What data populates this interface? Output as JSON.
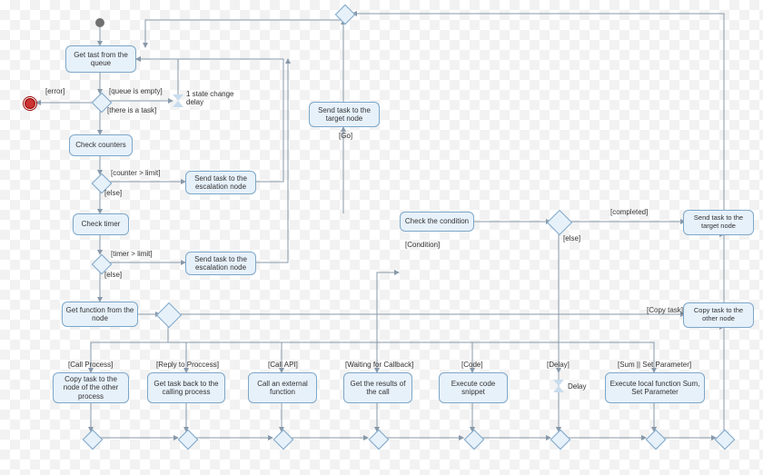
{
  "chart_data": {
    "type": "activity-diagram",
    "title": "",
    "nodes": [
      {
        "id": "start",
        "kind": "initial"
      },
      {
        "id": "errorEnd",
        "kind": "final"
      },
      {
        "id": "getTask",
        "kind": "action",
        "label": "Get tast from\nthe queue"
      },
      {
        "id": "d_queue",
        "kind": "decision"
      },
      {
        "id": "delayState",
        "kind": "timer",
        "label": "1 state change\ndelay"
      },
      {
        "id": "checkCounters",
        "kind": "action",
        "label": "Check counters"
      },
      {
        "id": "d_counter",
        "kind": "decision"
      },
      {
        "id": "escal1",
        "kind": "action",
        "label": "Send task to the\nescalation node"
      },
      {
        "id": "checkTimer",
        "kind": "action",
        "label": "Check timer"
      },
      {
        "id": "d_timer",
        "kind": "decision"
      },
      {
        "id": "escal2",
        "kind": "action",
        "label": "Send task to the\nescalation node"
      },
      {
        "id": "getFunc",
        "kind": "action",
        "label": "Get function from\nthe node"
      },
      {
        "id": "d_func",
        "kind": "decision"
      },
      {
        "id": "copyTaskProc",
        "kind": "action",
        "label": "Copy task to the\nnode of the other\nprocess"
      },
      {
        "id": "getBack",
        "kind": "action",
        "label": "Get task back to\nthe calling process"
      },
      {
        "id": "callApi",
        "kind": "action",
        "label": "Call an external\nfunction"
      },
      {
        "id": "getResults",
        "kind": "action",
        "label": "Get the results\nof the call"
      },
      {
        "id": "execCode",
        "kind": "action",
        "label": "Execute code\nsnippet"
      },
      {
        "id": "delay2",
        "kind": "timer",
        "label": "Delay"
      },
      {
        "id": "execLocal",
        "kind": "action",
        "label": "Execute local function\nSum, Set Parameter"
      },
      {
        "id": "sendTarget1",
        "kind": "action",
        "label": "Send task to the\ntarget node"
      },
      {
        "id": "checkCond",
        "kind": "action",
        "label": "Check the condition"
      },
      {
        "id": "d_cond",
        "kind": "decision"
      },
      {
        "id": "sendTarget2",
        "kind": "action",
        "label": "Send task to the\ntarget node"
      },
      {
        "id": "copyOther",
        "kind": "action",
        "label": "Copy task to the\nother node"
      },
      {
        "id": "merge_top",
        "kind": "merge"
      },
      {
        "id": "merge_bottom",
        "kind": "merge"
      }
    ],
    "guards": {
      "error": "[error]",
      "queueEmpty": "[queue is empty]",
      "thereTask": "[there is a task]",
      "counterLimit": "[counter > limit]",
      "else1": "[else]",
      "timerLimit": "[timer > limit]",
      "else2": "[else]",
      "go": "[Go]",
      "condition": "[Condition]",
      "else3": "[else]",
      "completed": "[completed]",
      "copyTask": "[Copy task]",
      "callProcess": "[Call Process]",
      "replyProcess": "[Reply to Proccess]",
      "callAPI": "[Call API]",
      "waitCb": "[Waiting for Callback]",
      "code": "[Code]",
      "delay": "[Delay]",
      "sumSet": "[Sum || Set Parameter]"
    }
  },
  "labels": {
    "getTask": "Get tast from the queue",
    "checkCounters": "Check counters",
    "escal1": "Send task to the escalation node",
    "checkTimer": "Check timer",
    "escal2": "Send task to the escalation node",
    "getFunc": "Get function from the node",
    "copyTaskProc": "Copy task to the node of the other process",
    "getBack": "Get task back to the calling process",
    "callApi": "Call an external function",
    "getResults": "Get the results of the call",
    "execCode": "Execute code snippet",
    "execLocal": "Execute local function Sum, Set Parameter",
    "sendTarget1": "Send task to the target node",
    "checkCond": "Check the condition",
    "sendTarget2": "Send task to the target node",
    "copyOther": "Copy task to the other node",
    "stateDelay": "1 state change delay",
    "delay": "Delay"
  },
  "guards": {
    "error": "[error]",
    "queueEmpty": "[queue is empty]",
    "thereTask": "[there is a task]",
    "counterLimit": "[counter > limit]",
    "else1": "[else]",
    "timerLimit": "[timer > limit]",
    "else2": "[else]",
    "go": "[Go]",
    "condition": "[Condition]",
    "else3": "[else]",
    "completed": "[completed]",
    "copyTask": "[Copy task]",
    "callProcess": "[Call Process]",
    "replyProcess": "[Reply to Proccess]",
    "callAPI": "[Call API]",
    "waitCb": "[Waiting for Callback]",
    "code": "[Code]",
    "delay": "[Delay]",
    "sumSet": "[Sum || Set Parameter]"
  }
}
